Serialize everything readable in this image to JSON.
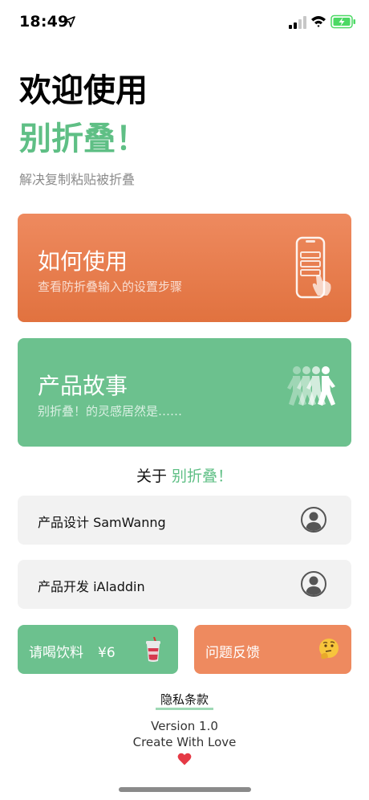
{
  "status_bar": {
    "time": "18:49",
    "icons": [
      "location-arrow-icon",
      "signal-icon",
      "wifi-icon",
      "battery-charging-icon"
    ],
    "battery_color": "#4cd964"
  },
  "header": {
    "title_line1": "欢迎使用",
    "title_line2": "别折叠！",
    "subtitle": "解决复制粘贴被折叠"
  },
  "cards": {
    "how_to": {
      "title": "如何使用",
      "desc": "查看防折叠输入的设置步骤",
      "icon": "phone-tap-icon",
      "color": "#e97f4f"
    },
    "story": {
      "title": "产品故事",
      "desc": "别折叠！的灵感居然是……",
      "icon": "walking-people-icon",
      "color": "#6cc18e"
    }
  },
  "about": {
    "prefix": "关于",
    "app_name": "别折叠！"
  },
  "credits": {
    "designer": "产品设计 SamWanng",
    "developer": "产品开发 iAladdin"
  },
  "actions": {
    "drink_label": "请喝饮料",
    "drink_price": "¥6",
    "feedback_label": "问题反馈"
  },
  "footer": {
    "privacy": "隐私条款",
    "version": "Version 1.0",
    "tagline": "Create With Love",
    "heart_icon": "red-heart-icon"
  },
  "colors": {
    "accent_green": "#5fbf85",
    "accent_orange": "#e97f4f"
  }
}
